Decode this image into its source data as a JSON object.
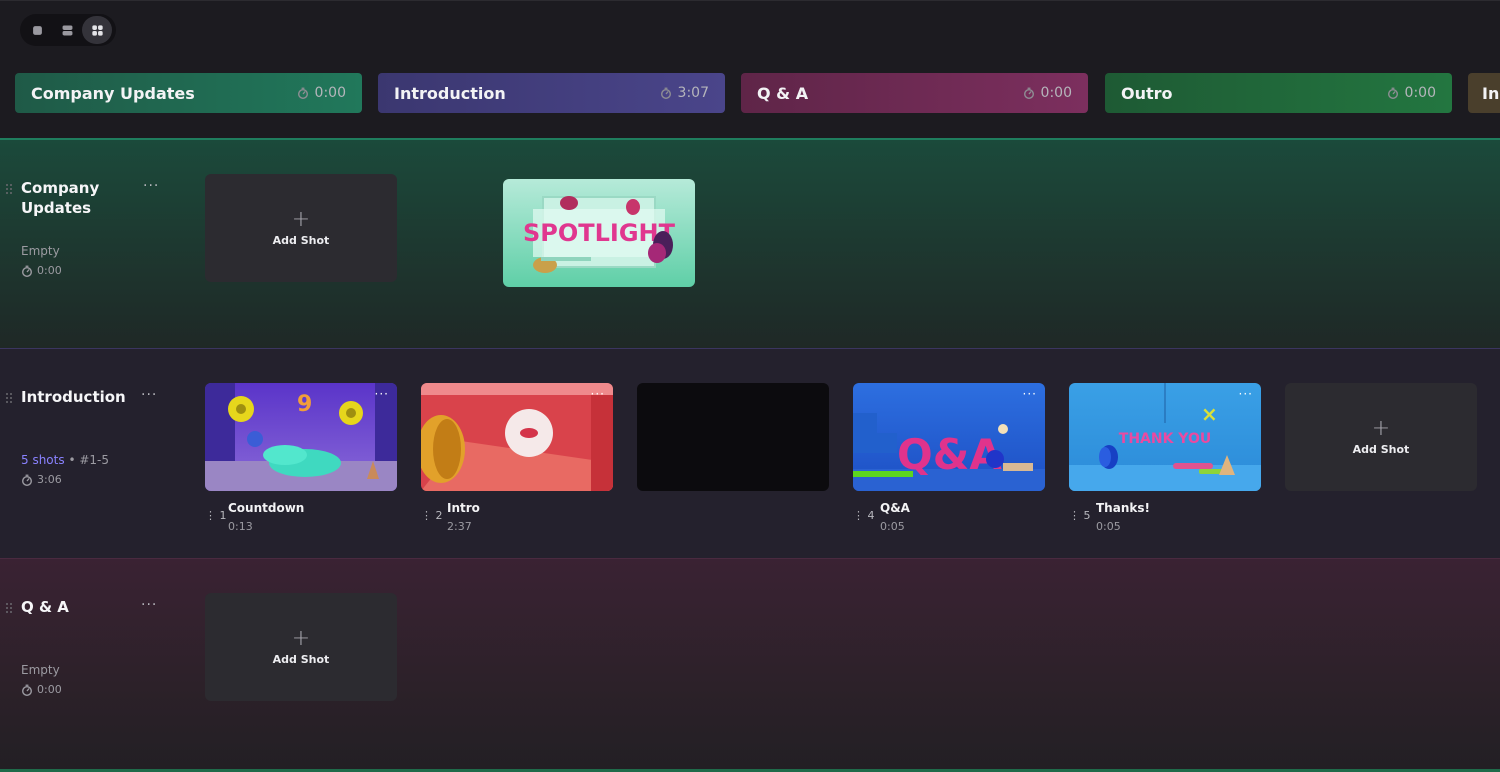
{
  "view_toggle": {
    "options": [
      "single-view-icon",
      "double-view-icon",
      "grid-view-icon"
    ],
    "active_index": 2
  },
  "segments": [
    {
      "title": "Company Updates",
      "duration": "0:00",
      "color": "#1f6b52"
    },
    {
      "title": "Introduction",
      "duration": "3:07",
      "color": "#3e3a78"
    },
    {
      "title": "Q & A",
      "duration": "0:00",
      "color": "#6b2a52"
    },
    {
      "title": "Outro",
      "duration": "0:00",
      "color": "#226b3c"
    },
    {
      "title": "In",
      "duration": "",
      "color": "#4a3f2c"
    }
  ],
  "sections": {
    "company_updates": {
      "title": "Company Updates",
      "status": "Empty",
      "duration": "0:00",
      "add_shot_label": "Add Shot"
    },
    "introduction": {
      "title": "Introduction",
      "shots_count": "5 shots",
      "shots_range": "#1-5",
      "duration": "3:06",
      "add_shot_label": "Add Shot",
      "shots": [
        {
          "num": "1",
          "title": "Countdown",
          "duration": "0:13"
        },
        {
          "num": "2",
          "title": "Intro",
          "duration": "2:37"
        },
        {
          "num": "",
          "title": "",
          "duration": ""
        },
        {
          "num": "4",
          "title": "Q&A",
          "duration": "0:05"
        },
        {
          "num": "5",
          "title": "Thanks!",
          "duration": "0:05"
        }
      ]
    },
    "qa": {
      "title": "Q & A",
      "status": "Empty",
      "duration": "0:00",
      "add_shot_label": "Add Shot"
    }
  },
  "thumbnails": {
    "spotlight_text": "SPOTLIGHT",
    "qa_text": "Q&A",
    "thanks_text": "THANK YOU"
  },
  "more_label": "···",
  "shots_separator": "•"
}
